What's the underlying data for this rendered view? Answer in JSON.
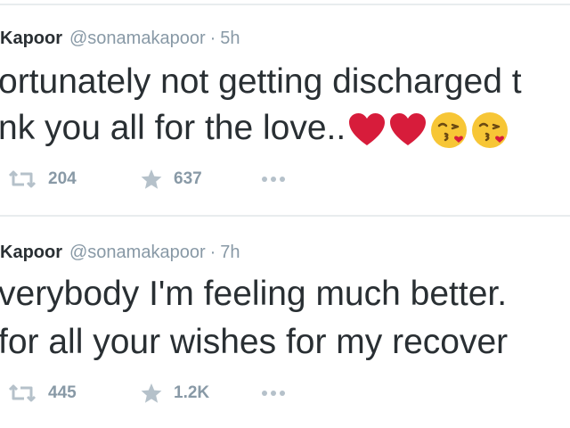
{
  "tweets": [
    {
      "author_name": "Kapoor",
      "handle": "@sonamakapoor",
      "separator": "·",
      "time": "5h",
      "text_line1": "ortunately not getting discharged t",
      "text_line2": "nk you all for the love..",
      "emojis": [
        "heart-icon",
        "heart-icon",
        "kissing-face-icon",
        "kissing-face-icon"
      ],
      "retweets": "204",
      "favorites": "637"
    },
    {
      "author_name": "Kapoor",
      "handle": "@sonamakapoor",
      "separator": "·",
      "time": "7h",
      "text_line1": "verybody I'm feeling much better.",
      "text_line2": "for all your wishes for my recover",
      "emojis": [],
      "retweets": "445",
      "favorites": "1.2K"
    }
  ],
  "icons": {
    "retweet": "retweet-icon",
    "favorite": "star-icon",
    "more": "more-icon"
  },
  "colors": {
    "heart": "#d71c3b",
    "face": "#f7c636",
    "icon_gray": "#b5c1ca",
    "meta_gray": "#8899a6"
  }
}
